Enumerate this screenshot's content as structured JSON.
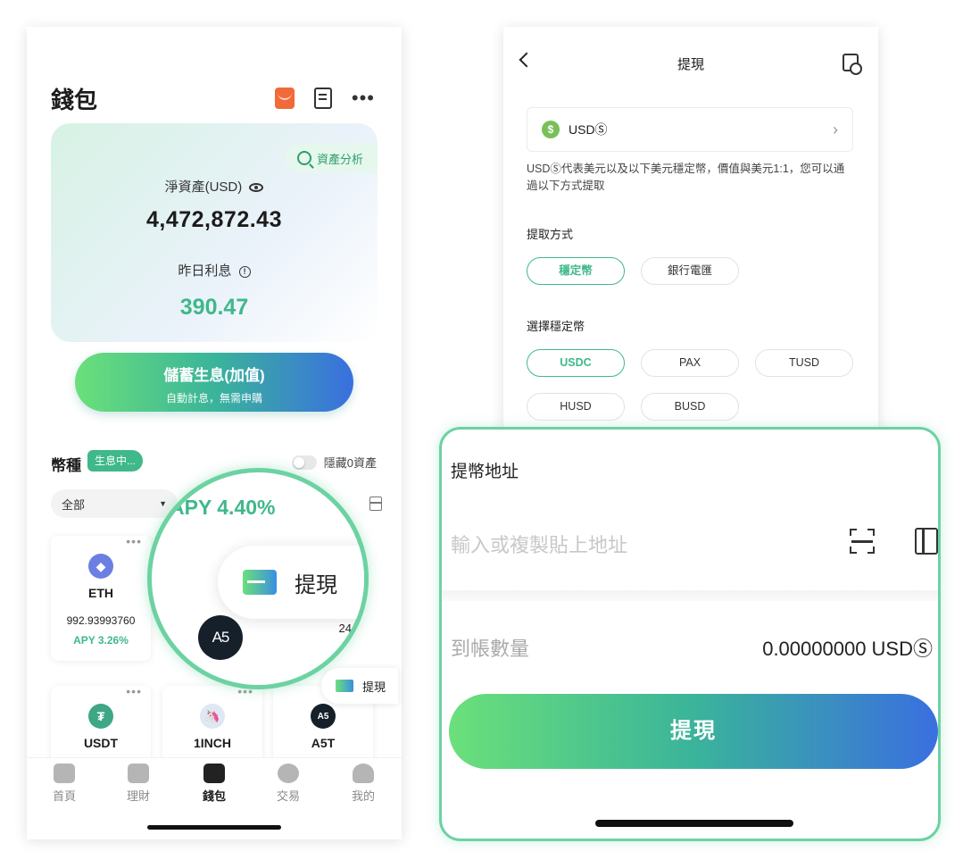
{
  "wallet": {
    "title": "錢包",
    "asset_analysis": "資產分析",
    "net_assets_label": "淨資產(USD)",
    "net_assets_value": "4,472,872.43",
    "interest_label": "昨日利息",
    "interest_value": "390.47",
    "save_button_title": "儲蓄生息(加值)",
    "save_button_sub": "自動計息，無需申購",
    "coins_title": "幣種",
    "earning_badge": "生息中...",
    "hide_zero": "隱藏0資產",
    "filter_value": "全部",
    "coins": [
      {
        "name": "ETH",
        "amount": "992.93993760",
        "apy": "APY 3.26%",
        "color": "#6b7fe3",
        "icon": "eth-icon"
      },
      {
        "name": "USDT",
        "color": "#3fa686",
        "icon": "tether-icon"
      },
      {
        "name": "1INCH",
        "color": "#dfe7f3",
        "icon": "1inch-icon"
      },
      {
        "name": "A5T",
        "color": "#15202b",
        "icon": "a5t-icon"
      }
    ],
    "magnifier": {
      "apy": "APY 4.40%",
      "withdraw_label": "提現",
      "a5_logo": "A5",
      "side_number": "24"
    },
    "mini_withdraw": "提現",
    "nav": [
      {
        "label": "首頁",
        "icon": "home-icon"
      },
      {
        "label": "理財",
        "icon": "chart-icon"
      },
      {
        "label": "錢包",
        "icon": "wallet-icon"
      },
      {
        "label": "交易",
        "icon": "exchange-icon"
      },
      {
        "label": "我的",
        "icon": "user-icon"
      }
    ]
  },
  "withdraw": {
    "title": "提現",
    "currency": "USDⓈ",
    "currency_icon_text": "$",
    "note": "USDⓈ代表美元以及以下美元穩定幣，價值與美元1:1，您可以通過以下方式提取",
    "method_label": "提取方式",
    "methods": [
      "穩定幣",
      "銀行電匯"
    ],
    "stablecoin_label": "選擇穩定幣",
    "stablecoins": [
      "USDC",
      "PAX",
      "TUSD",
      "HUSD",
      "BUSD"
    ]
  },
  "zoom": {
    "address_label": "提幣地址",
    "address_placeholder": "輸入或複製貼上地址",
    "amount_label": "到帳數量",
    "amount_value": "0.00000000 USDⓈ",
    "button": "提現"
  },
  "colors": {
    "accent": "#3fb88a",
    "gradient_start": "#6be07a",
    "gradient_end": "#3a6fe0",
    "highlight": "#6cd2a2"
  }
}
